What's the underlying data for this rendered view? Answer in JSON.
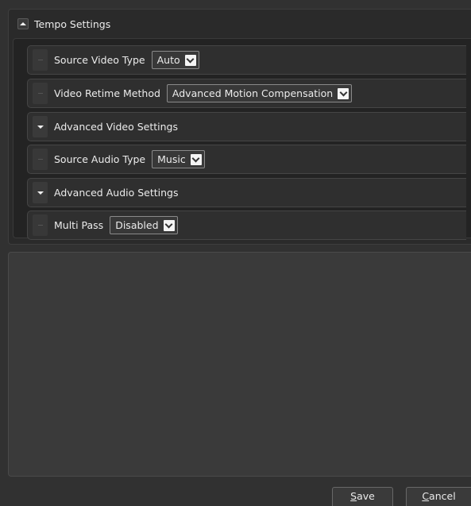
{
  "section": {
    "title": "Tempo Settings"
  },
  "rows": [
    {
      "label": "Source Video Type",
      "value": "Auto"
    },
    {
      "label": "Video Retime Method",
      "value": "Advanced Motion Compensation"
    },
    {
      "label": "Advanced Video Settings"
    },
    {
      "label": "Source Audio Type",
      "value": "Music"
    },
    {
      "label": "Advanced Audio Settings"
    },
    {
      "label": "Multi Pass",
      "value": "Disabled"
    }
  ],
  "buttons": {
    "save_mnemonic": "S",
    "save_rest": "ave",
    "cancel_mnemonic": "C",
    "cancel_rest": "ancel"
  }
}
